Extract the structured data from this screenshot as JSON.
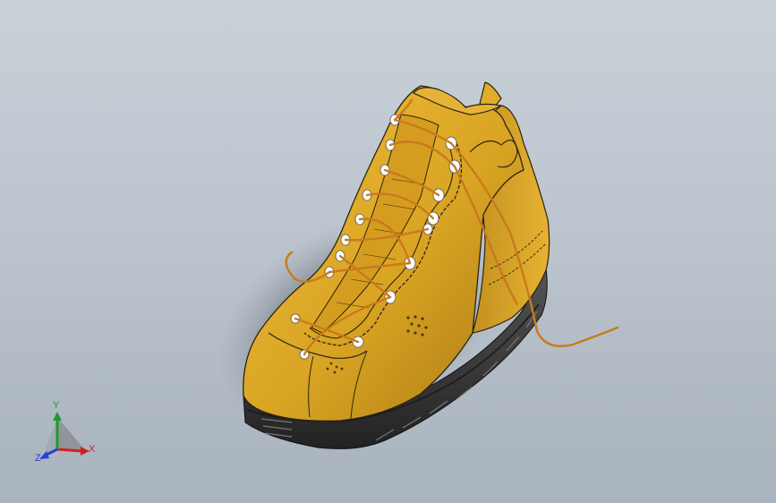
{
  "viewport": {
    "background_top": "#c9d0d8",
    "background_bottom": "#a9b3bd"
  },
  "model": {
    "icon": "hiking-boot-3d-model",
    "upper_color": "#d9a423",
    "lace_color": "#c97a1c",
    "sole_color": "#3c3c3c",
    "eyelet_color": "#ffffff"
  },
  "triad": {
    "x_label": "X",
    "y_label": "Y",
    "z_label": "Z",
    "x_color": "#d42020",
    "y_color": "#1d9a2a",
    "z_color": "#2a3fd6"
  }
}
